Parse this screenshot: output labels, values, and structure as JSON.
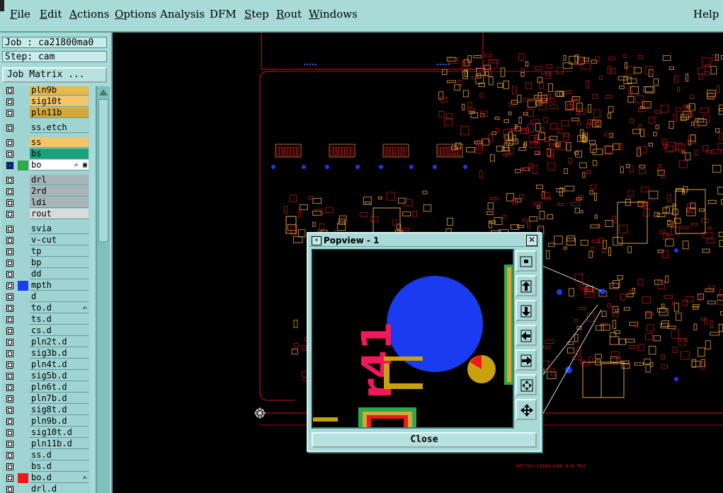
{
  "menu": {
    "items": [
      {
        "key": "file",
        "label": "File",
        "underline": "F",
        "rest": "ile"
      },
      {
        "key": "edit",
        "label": "Edit",
        "underline": "E",
        "rest": "dit"
      },
      {
        "key": "actions",
        "label": "Actions",
        "underline": "A",
        "rest": "ctions"
      },
      {
        "key": "options",
        "label": "Options",
        "underline": "O",
        "rest": "ptions"
      },
      {
        "key": "analysis",
        "label": "Analysis",
        "underline": "",
        "rest": "Analysis"
      },
      {
        "key": "dfm",
        "label": "DFM",
        "underline": "",
        "rest": "DFM"
      },
      {
        "key": "step",
        "label": "Step",
        "underline": "S",
        "rest": "tep"
      },
      {
        "key": "rout",
        "label": "Rout",
        "underline": "R",
        "rest": "out"
      },
      {
        "key": "windows",
        "label": "Windows",
        "underline": "W",
        "rest": "indows"
      }
    ],
    "help": "Help"
  },
  "job": {
    "label": "Job : ca21800ma0",
    "step": "Step: cam",
    "matrix_button": "Job Matrix ..."
  },
  "layers": [
    {
      "name": "pln9b",
      "color": "#e8b84a",
      "mark": ""
    },
    {
      "name": "sig10t",
      "color": "#f5c56a",
      "mark": ""
    },
    {
      "name": "pln11b",
      "color": "#d4a838",
      "mark": ""
    },
    {
      "name": "ss.etch",
      "color": "#9fd4d2",
      "mark": "",
      "gap": true
    },
    {
      "name": "ss",
      "color": "#f5c56a",
      "mark": "",
      "gap": true
    },
    {
      "name": "bs",
      "color": "#1aa37a",
      "mark": ""
    },
    {
      "name": "bo",
      "color": "#ffffff",
      "mark": "#2fa84a",
      "icon": "✍ ▣",
      "selected": true
    },
    {
      "name": "drl",
      "color": "#a8b4b8",
      "mark": "",
      "gap": true
    },
    {
      "name": "2rd",
      "color": "#a8b4b8",
      "mark": ""
    },
    {
      "name": "ldi",
      "color": "#a8b4b8",
      "mark": ""
    },
    {
      "name": "rout",
      "color": "#d8dcd8",
      "mark": ""
    },
    {
      "name": "svia",
      "color": "#9fd4d2",
      "mark": "",
      "gap": true
    },
    {
      "name": "v-cut",
      "color": "#9fd4d2",
      "mark": ""
    },
    {
      "name": "tp",
      "color": "#9fd4d2",
      "mark": ""
    },
    {
      "name": "bp",
      "color": "#9fd4d2",
      "mark": ""
    },
    {
      "name": "dd",
      "color": "#9fd4d2",
      "mark": ""
    },
    {
      "name": "mpth",
      "color": "#9fd4d2",
      "mark": "#1a3cf0"
    },
    {
      "name": "d",
      "color": "#9fd4d2",
      "mark": ""
    },
    {
      "name": "to.d",
      "color": "#9fd4d2",
      "mark": "",
      "icon": "✍"
    },
    {
      "name": "ts.d",
      "color": "#9fd4d2",
      "mark": ""
    },
    {
      "name": "cs.d",
      "color": "#9fd4d2",
      "mark": ""
    },
    {
      "name": "pln2t.d",
      "color": "#9fd4d2",
      "mark": ""
    },
    {
      "name": "sig3b.d",
      "color": "#9fd4d2",
      "mark": ""
    },
    {
      "name": "pln4t.d",
      "color": "#9fd4d2",
      "mark": ""
    },
    {
      "name": "sig5b.d",
      "color": "#9fd4d2",
      "mark": ""
    },
    {
      "name": "pln6t.d",
      "color": "#9fd4d2",
      "mark": ""
    },
    {
      "name": "pln7b.d",
      "color": "#9fd4d2",
      "mark": ""
    },
    {
      "name": "sig8t.d",
      "color": "#9fd4d2",
      "mark": ""
    },
    {
      "name": "pln9b.d",
      "color": "#9fd4d2",
      "mark": ""
    },
    {
      "name": "sig10t.d",
      "color": "#9fd4d2",
      "mark": ""
    },
    {
      "name": "pln11b.d",
      "color": "#9fd4d2",
      "mark": ""
    },
    {
      "name": "ss.d",
      "color": "#9fd4d2",
      "mark": ""
    },
    {
      "name": "bs.d",
      "color": "#9fd4d2",
      "mark": ""
    },
    {
      "name": "bo.d",
      "color": "#9fd4d2",
      "mark": "#f01818",
      "icon": "✍"
    },
    {
      "name": "drl.d",
      "color": "#9fd4d2",
      "mark": ""
    }
  ],
  "canvas": {
    "footer_text": "H0TT0S/ID800/LN8 W/H MED",
    "colors": {
      "trace": "#e8a23a",
      "outline": "#d01818",
      "pad": "#1a3cf0"
    }
  },
  "popview": {
    "title": "Popview - 1",
    "close_label": "Close",
    "tools": [
      "zoom-window-icon",
      "zoom-in-icon",
      "zoom-out-icon",
      "pan-left-icon",
      "pan-right-icon",
      "zoom-fit-icon",
      "zoom-home-icon"
    ]
  }
}
